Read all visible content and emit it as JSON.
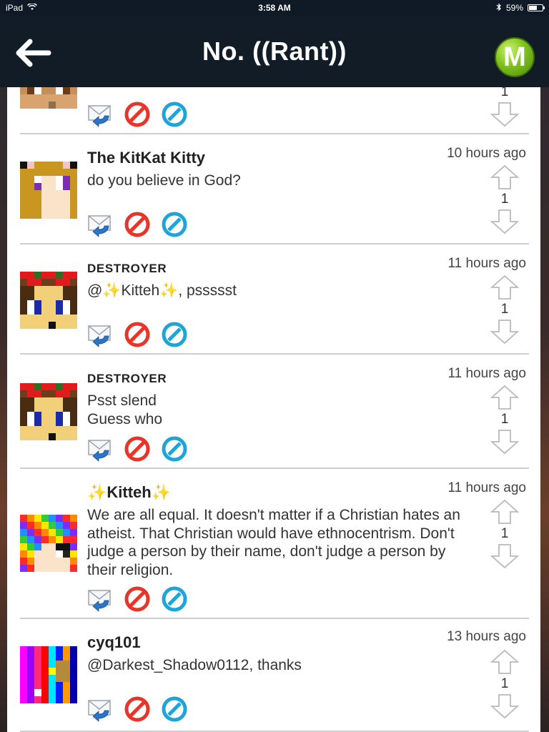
{
  "status_bar": {
    "device": "iPad",
    "time": "3:58 AM",
    "battery": "59%",
    "battery_level": 0.59
  },
  "nav": {
    "title": "No. ((Rant))",
    "logo_letter": "M"
  },
  "top_partial": {
    "score": "1"
  },
  "comments": [
    {
      "author": "The KitKat Kitty",
      "time": "10 hours ago",
      "text": "do you believe in God?",
      "score": "1"
    },
    {
      "author": "DESTROYER",
      "time": "11 hours ago",
      "text": "@✨Kitteh✨, pssssst",
      "score": "1"
    },
    {
      "author": "DESTROYER",
      "time": "11 hours ago",
      "text": "Psst slend\nGuess who",
      "score": "1"
    },
    {
      "author": "✨Kitteh✨",
      "time": "11 hours ago",
      "text": "We are all equal. It doesn't matter if a Christian hates an atheist. That Christian would have ethnocentrism. Don't judge a person by their name, don't judge a person by their religion.",
      "score": "1"
    },
    {
      "author": "cyq101",
      "time": "13 hours ago",
      "text": "@Darkest_Shadow0112, thanks",
      "score": "1"
    }
  ],
  "icons": {
    "back": "back-arrow-icon",
    "reply": "reply-envelope-icon",
    "block": "block-icon",
    "flag": "flag-icon",
    "upvote": "upvote-arrow-icon",
    "downvote": "downvote-arrow-icon"
  },
  "colors": {
    "nav_bg": "#121c27",
    "block_red": "#e8352a",
    "flag_blue": "#1ea4d8",
    "logo_green": "#7fc21e"
  }
}
